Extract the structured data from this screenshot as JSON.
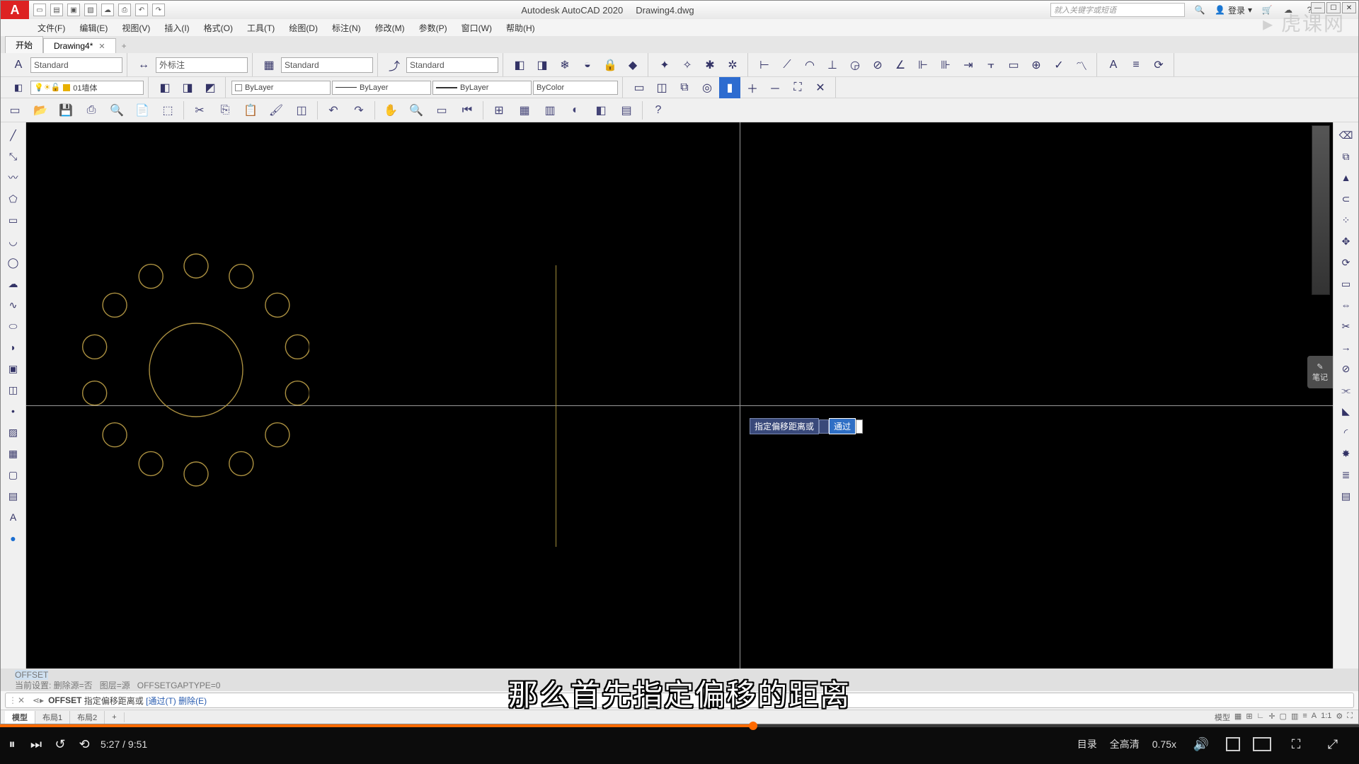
{
  "title": {
    "app": "Autodesk AutoCAD 2020",
    "doc": "Drawing4.dwg"
  },
  "search_placeholder": "就入关键字或短语",
  "login": "登录",
  "menus": [
    "文件(F)",
    "编辑(E)",
    "视图(V)",
    "插入(I)",
    "格式(O)",
    "工具(T)",
    "绘图(D)",
    "标注(N)",
    "修改(M)",
    "参数(P)",
    "窗口(W)",
    "帮助(H)"
  ],
  "doc_tabs": {
    "start": "开始",
    "active": "Drawing4*",
    "plus": "+"
  },
  "styles": {
    "text": "Standard",
    "dim": "外标注",
    "table": "Standard",
    "ml": "Standard"
  },
  "layers": {
    "current": "01墙体",
    "linetype": "ByLayer",
    "lineweight": "ByLayer",
    "color": "ByLayer",
    "plotstyle": "ByColor"
  },
  "layout_tabs": [
    "模型",
    "布局1",
    "布局2",
    "+"
  ],
  "cmd": {
    "hist1": "OFFSET",
    "hist2_a": "当前设置: 删除源=否",
    "hist2_b": "图层=源",
    "hist2_c": "OFFSETGAPTYPE=0",
    "prompt_kw": "OFFSET",
    "prompt_txt": "指定偏移距离或",
    "prompt_opt": "[通过(T) 删除(E)"
  },
  "dynamic_input": {
    "label": "指定偏移距离或",
    "val": "通过"
  },
  "notes_btn": "笔记",
  "subtitle": "那么首先指定偏移的距离",
  "player": {
    "current": "5:27",
    "total": "9:51",
    "menu": "目录",
    "quality": "全高清",
    "speed": "0.75x"
  },
  "watermark": "虎课网"
}
